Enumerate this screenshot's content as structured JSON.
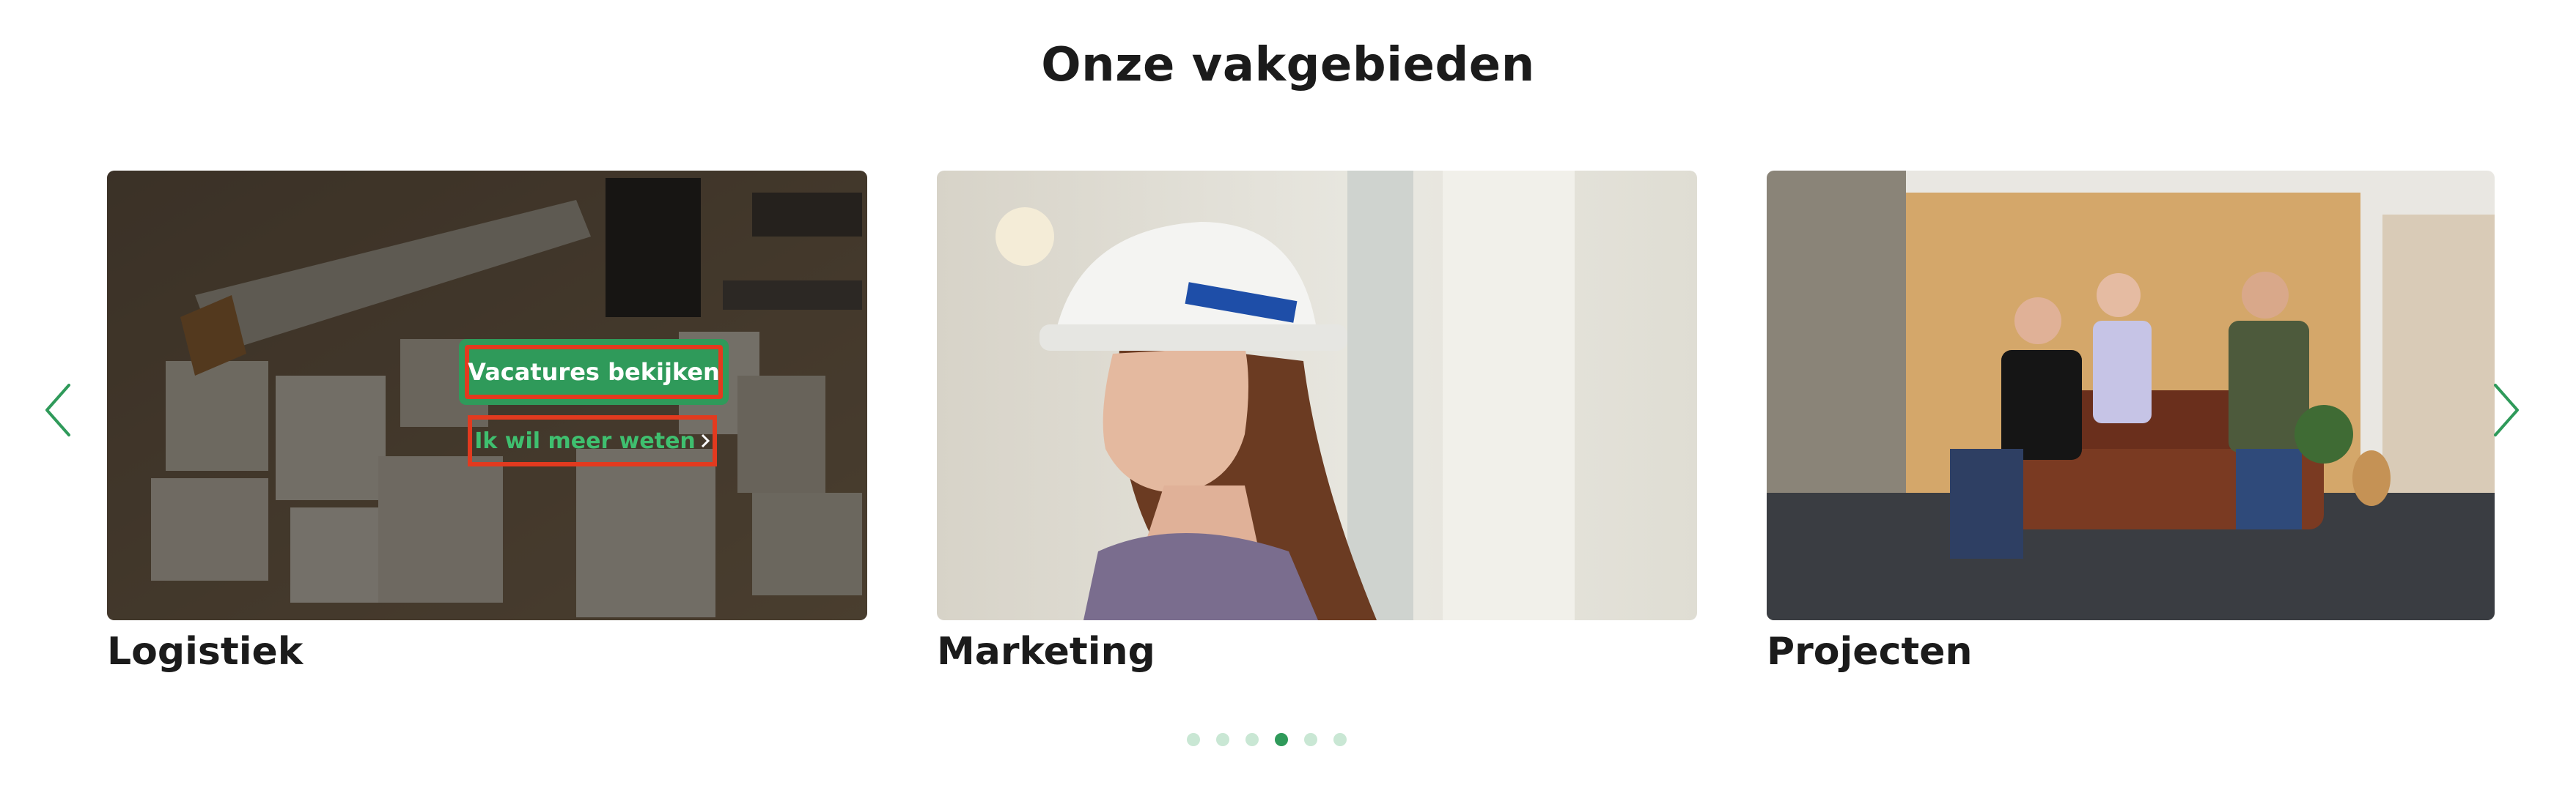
{
  "section": {
    "title": "Onze vakgebieden"
  },
  "carousel": {
    "prev_icon": "chevron-left-icon",
    "next_icon": "chevron-right-icon",
    "cards": [
      {
        "label": "Logistiek",
        "primary_button": "Vacatures bekijken",
        "secondary_button": "Ik wil meer weten"
      },
      {
        "label": "Marketing"
      },
      {
        "label": "Projecten"
      }
    ],
    "dots": {
      "count": 6,
      "active_index": 3
    }
  },
  "colors": {
    "accent": "#2f9a5a",
    "accent_light": "#3fbf6f",
    "highlight_outline": "#e23a1f",
    "dot_inactive": "#c9e7d4"
  }
}
